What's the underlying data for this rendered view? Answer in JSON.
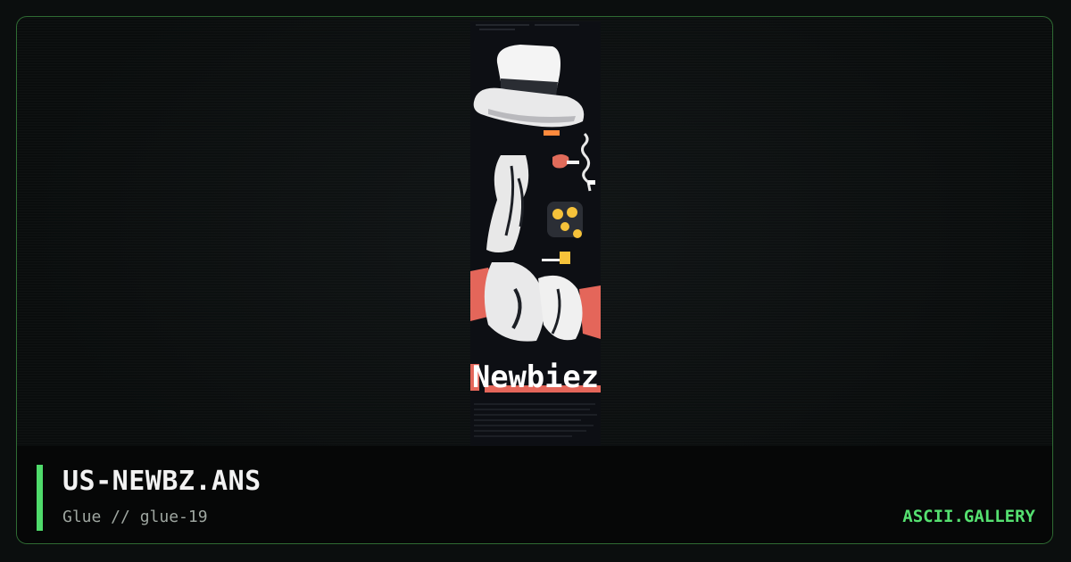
{
  "artwork": {
    "logo_text": "Newbiez"
  },
  "footer": {
    "title": "US-NEWBZ.ANS",
    "subtitle": "Glue // glue-19",
    "brand": "ASCII.GALLERY"
  },
  "colors": {
    "accent": "#4fdb6b",
    "brand": "#55e070",
    "frame_border": "#2f6b33",
    "background": "#0b0e0e"
  }
}
